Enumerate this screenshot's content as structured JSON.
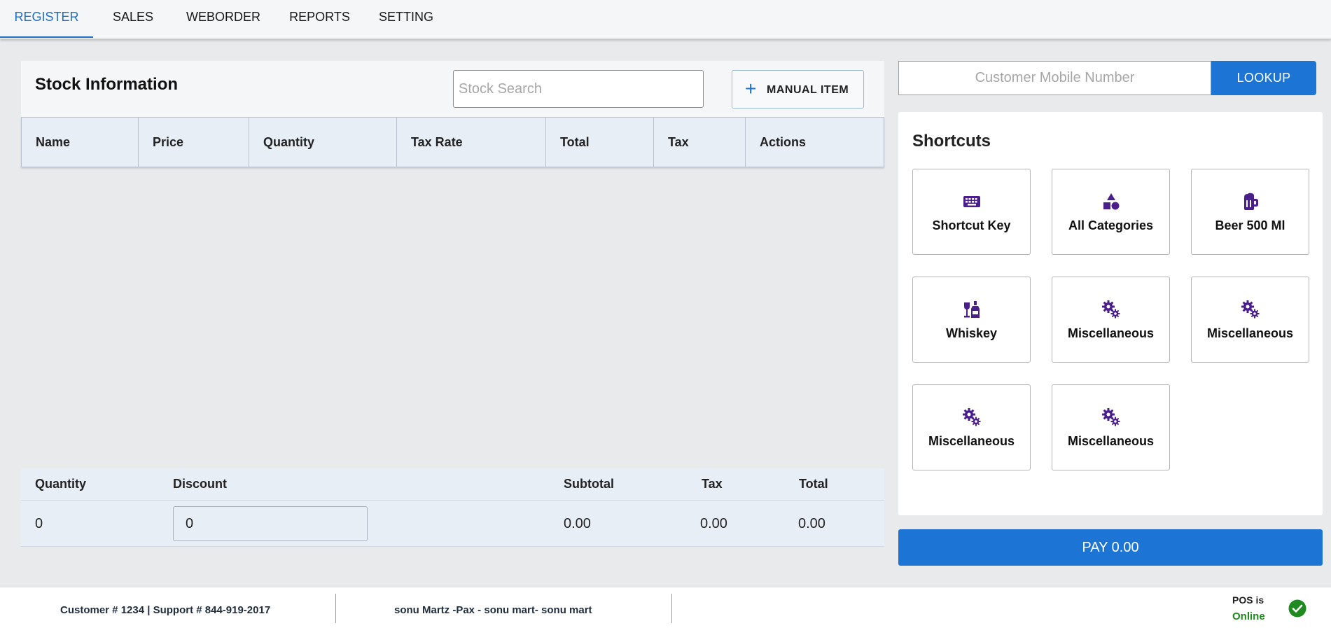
{
  "nav": {
    "tabs": [
      {
        "label": "REGISTER",
        "active": true
      },
      {
        "label": "SALES",
        "active": false
      },
      {
        "label": "WEBORDER",
        "active": false
      },
      {
        "label": "REPORTS",
        "active": false
      },
      {
        "label": "SETTING",
        "active": false
      }
    ]
  },
  "stock": {
    "title": "Stock Information",
    "search_placeholder": "Stock Search",
    "manual_item_label": "MANUAL ITEM",
    "columns": [
      "Name",
      "Price",
      "Quantity",
      "Tax Rate",
      "Total",
      "Tax",
      "Actions"
    ]
  },
  "summary": {
    "headers": {
      "quantity": "Quantity",
      "discount": "Discount",
      "subtotal": "Subtotal",
      "tax": "Tax",
      "total": "Total"
    },
    "values": {
      "quantity": "0",
      "discount": "0",
      "subtotal": "0.00",
      "tax": "0.00",
      "total": "0.00"
    }
  },
  "customer": {
    "mobile_placeholder": "Customer Mobile Number",
    "lookup_label": "LOOKUP"
  },
  "shortcuts": {
    "title": "Shortcuts",
    "items": [
      {
        "label": "Shortcut Key",
        "icon": "keyboard-icon"
      },
      {
        "label": "All Categories",
        "icon": "shapes-icon"
      },
      {
        "label": "Beer 500 Ml",
        "icon": "beer-mug-icon"
      },
      {
        "label": "Whiskey",
        "icon": "wine-bottle-glass-icon"
      },
      {
        "label": "Miscellaneous",
        "icon": "gears-icon"
      },
      {
        "label": "Miscellaneous",
        "icon": "gears-icon"
      },
      {
        "label": "Miscellaneous",
        "icon": "gears-icon"
      },
      {
        "label": "Miscellaneous",
        "icon": "gears-icon"
      }
    ],
    "icon_color": "#4a1f8c"
  },
  "pay": {
    "label": "PAY 0.00"
  },
  "footer": {
    "customer_support": "Customer # 1234 | Support # 844-919-2017",
    "store": "sonu Martz -Pax - sonu mart- sonu mart",
    "pos_label": "POS is",
    "pos_status": "Online",
    "status_color": "#1f8a1f"
  },
  "colors": {
    "accent": "#1c74d4",
    "active_tab": "#1f6fc9",
    "header_bg": "#e8eef6"
  }
}
